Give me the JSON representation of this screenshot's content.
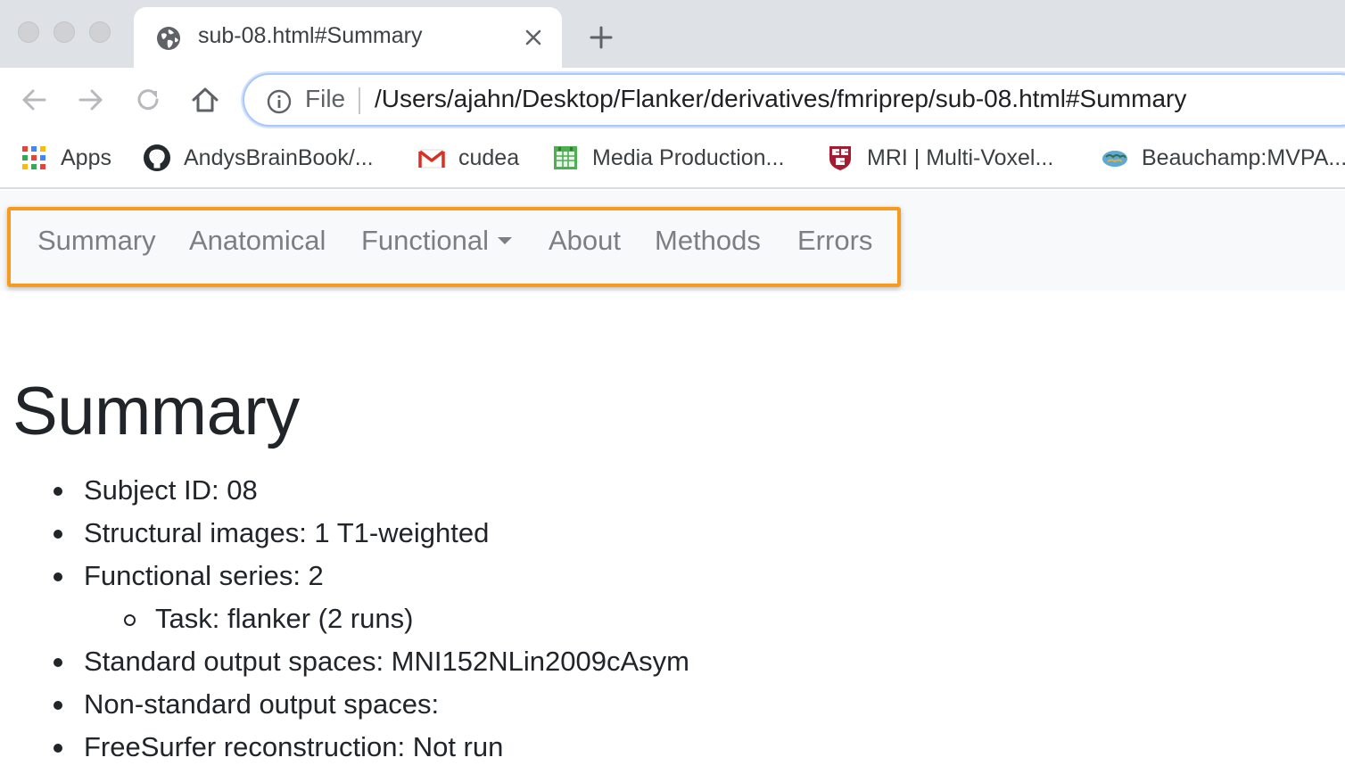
{
  "browser": {
    "tab": {
      "title": "sub-08.html#Summary"
    },
    "address_bar": {
      "scheme_label": "File",
      "url": "/Users/ajahn/Desktop/Flanker/derivatives/fmriprep/sub-08.html#Summary"
    },
    "bookmarks": [
      {
        "label": "Apps",
        "icon": "apps-grid-icon"
      },
      {
        "label": "AndysBrainBook/...",
        "icon": "github-icon"
      },
      {
        "label": "cudea",
        "icon": "gmail-icon"
      },
      {
        "label": "Media Production...",
        "icon": "spreadsheet-icon"
      },
      {
        "label": "MRI | Multi-Voxel...",
        "icon": "harvard-shield-icon"
      },
      {
        "label": "Beauchamp:MVPA...",
        "icon": "brain-icon"
      }
    ]
  },
  "page": {
    "nav": {
      "items": [
        {
          "label": "Summary"
        },
        {
          "label": "Anatomical"
        },
        {
          "label": "Functional",
          "has_dropdown": true
        },
        {
          "label": "About"
        },
        {
          "label": "Methods"
        },
        {
          "label": "Errors"
        }
      ],
      "highlight_color": "#f79a1d"
    },
    "title": "Summary",
    "summary": [
      {
        "text": "Subject ID: 08",
        "level": 1
      },
      {
        "text": "Structural images: 1 T1-weighted",
        "level": 1
      },
      {
        "text": "Functional series: 2",
        "level": 1
      },
      {
        "text": "Task: flanker (2 runs)",
        "level": 2
      },
      {
        "text": "Standard output spaces: MNI152NLin2009cAsym",
        "level": 1
      },
      {
        "text": "Non-standard output spaces:",
        "level": 1
      },
      {
        "text": "FreeSurfer reconstruction: Not run",
        "level": 1
      }
    ]
  }
}
